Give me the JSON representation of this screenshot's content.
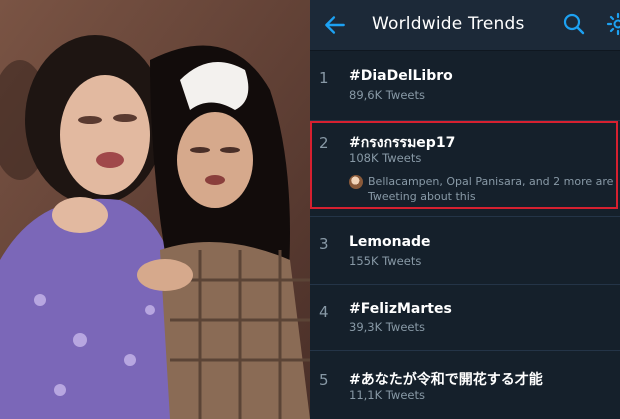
{
  "header": {
    "title": "Worldwide Trends",
    "back_icon": "arrow-left-icon",
    "search_icon": "search-icon",
    "settings_icon": "gear-icon"
  },
  "trends": [
    {
      "rank": "1",
      "name": "#DiaDelLibro",
      "count": "89,6K Tweets"
    },
    {
      "rank": "2",
      "name": "#กรงกรรมep17",
      "count": "108K Tweets",
      "context": "Bellacampen, Opal Panisara, and 2 more are Tweeting about this",
      "highlighted": true
    },
    {
      "rank": "3",
      "name": "Lemonade",
      "count": "155K Tweets"
    },
    {
      "rank": "4",
      "name": "#FelizMartes",
      "count": "39,3K Tweets"
    },
    {
      "rank": "5",
      "name": "#あなたが令和で開花する才能",
      "count": "11,1K Tweets"
    }
  ],
  "colors": {
    "background": "#15202b",
    "header": "#1c2938",
    "accent": "#1da1f2",
    "muted": "#8899a6",
    "highlight_border": "#d62030"
  }
}
